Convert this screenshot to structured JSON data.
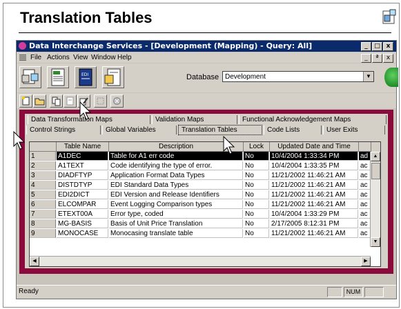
{
  "slide": {
    "title": "Translation Tables"
  },
  "window": {
    "title": "Data Interchange Services - [Development (Mapping)  -  Query: All]",
    "buttons": [
      "_",
      "□",
      "x"
    ],
    "mdi_buttons": [
      "_",
      "ª",
      "x"
    ]
  },
  "menu": [
    "File",
    "Actions",
    "View",
    "Window",
    "Help"
  ],
  "database": {
    "label": "Database",
    "value": "Development"
  },
  "tabs_row1": [
    "Data Transformation Maps",
    "Validation Maps",
    "Functional Acknowledgement Maps"
  ],
  "tabs_row2": [
    "Control Strings",
    "Global Variables",
    "Translation Tables",
    "Code Lists",
    "User Exits"
  ],
  "active_tab": "Translation Tables",
  "table": {
    "headers": [
      "Table Name",
      "Description",
      "Lock",
      "Updated Date and Time"
    ],
    "rows": [
      {
        "num": "1",
        "name": "A1DEC",
        "desc": "Table for A1 err code",
        "lock": "No",
        "updated": "10/4/2004 1:33:34 PM",
        "extra": "ad"
      },
      {
        "num": "2",
        "name": "A1TEXT",
        "desc": "Code identifying the type of error.",
        "lock": "No",
        "updated": "10/4/2004 1:33:35 PM",
        "extra": "ac"
      },
      {
        "num": "3",
        "name": "DIADFTYP",
        "desc": "Application Format Data Types",
        "lock": "No",
        "updated": "11/21/2002 11:46:21 AM",
        "extra": "ac"
      },
      {
        "num": "4",
        "name": "DISTDTYP",
        "desc": "EDI Standard Data Types",
        "lock": "No",
        "updated": "11/21/2002 11:46:21 AM",
        "extra": "ac"
      },
      {
        "num": "5",
        "name": "EDI2DICT",
        "desc": "EDI Version and Release Identifiers",
        "lock": "No",
        "updated": "11/21/2002 11:46:21 AM",
        "extra": "ac"
      },
      {
        "num": "6",
        "name": "ELCOMPAR",
        "desc": "Event Logging Comparison types",
        "lock": "No",
        "updated": "11/21/2002 11:46:21 AM",
        "extra": "ac"
      },
      {
        "num": "7",
        "name": "ETEXT00A",
        "desc": "Error type, coded",
        "lock": "No",
        "updated": "10/4/2004 1:33:29 PM",
        "extra": "ac"
      },
      {
        "num": "8",
        "name": "MG-BASIS",
        "desc": "Basis of Unit Price Translation",
        "lock": "No",
        "updated": "2/17/2005 8:12:31 PM",
        "extra": "ac"
      },
      {
        "num": "9",
        "name": "MONOCASE",
        "desc": "Monocasing translate table",
        "lock": "No",
        "updated": "11/21/2002 11:46:21 AM",
        "extra": "ac"
      }
    ],
    "selected_row": 1
  },
  "status": {
    "text": "Ready",
    "num": "NUM"
  }
}
